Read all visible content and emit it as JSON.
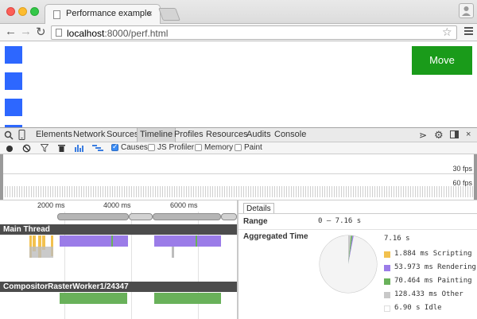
{
  "browser": {
    "tab_title": "Performance example",
    "tab_close": "×",
    "url_host": "localhost",
    "url_path": ":8000/perf.html",
    "back": "←",
    "forward": "→",
    "reload": "↻",
    "star": "☆",
    "profile": "👤"
  },
  "page": {
    "move_button": "Move",
    "square_color": "#2d67ff",
    "button_color": "#1a9b1a"
  },
  "devtools": {
    "tabs": [
      "Elements",
      "Network",
      "Sources",
      "Timeline",
      "Profiles",
      "Resources",
      "Audits",
      "Console"
    ],
    "active_tab": "Timeline",
    "toolbar": {
      "causes_label": "Causes",
      "js_profiler_label": "JS Profiler",
      "memory_label": "Memory",
      "paint_label": "Paint"
    },
    "overview": {
      "fps_30": "30 fps",
      "fps_60": "60 fps"
    },
    "ruler_ticks": [
      "2000 ms",
      "4000 ms",
      "6000 ms"
    ],
    "tracks": {
      "main": "Main Thread",
      "compositor": "CompositorRasterWorker1/24347"
    },
    "details": {
      "tab": "Details",
      "range_label": "Range",
      "range_value": "0 – 7.16 s",
      "aggregated_label": "Aggregated Time",
      "total": "7.16 s",
      "legend": [
        {
          "text": "1.884 ms Scripting",
          "color": "#f2c14e"
        },
        {
          "text": "53.973 ms Rendering",
          "color": "#9b7ce8"
        },
        {
          "text": "70.464 ms Painting",
          "color": "#69b15a"
        },
        {
          "text": "128.433 ms Other",
          "color": "#c8c8c8"
        },
        {
          "text": "6.90 s Idle",
          "color": "#ffffff"
        }
      ]
    }
  }
}
